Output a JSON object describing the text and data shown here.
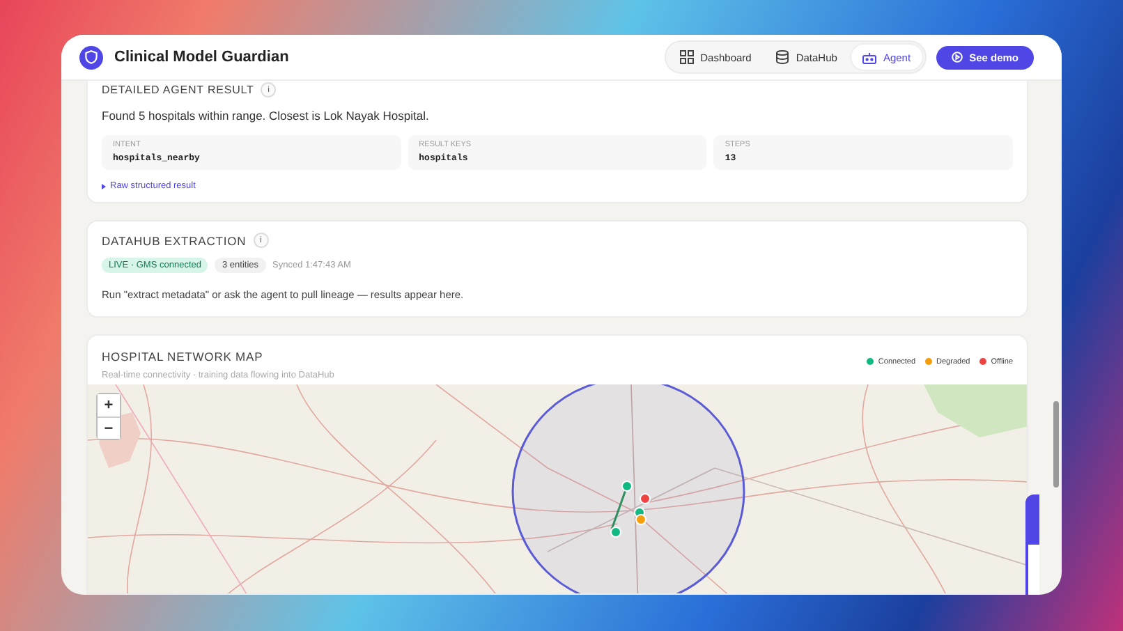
{
  "header": {
    "title": "Clinical Model Guardian",
    "nav": [
      {
        "label": "Dashboard",
        "kind": "grid",
        "selected": false
      },
      {
        "label": "DataHub",
        "kind": "database",
        "selected": false
      },
      {
        "label": "Agent",
        "kind": "bot",
        "selected": true
      }
    ],
    "demo_button": "See demo"
  },
  "agent_result": {
    "title": "DETAILED AGENT RESULT",
    "info": "i",
    "summary": "Found 5 hospitals within range. Closest is Lok Nayak Hospital.",
    "fields": [
      {
        "label": "INTENT",
        "value": "hospitals_nearby"
      },
      {
        "label": "RESULT KEYS",
        "value": "hospitals"
      },
      {
        "label": "STEPS",
        "value": "13"
      }
    ],
    "raw_link": "Raw structured result"
  },
  "datahub": {
    "title": "DATAHUB EXTRACTION",
    "info": "i",
    "badges": [
      {
        "label": "LIVE · GMS connected",
        "kind": "live"
      },
      {
        "label": "3 entities",
        "kind": "count"
      }
    ],
    "synced": "Synced 1:47:43 AM",
    "message": "Run \"extract metadata\" or ask the agent to pull lineage — results appear here."
  },
  "map": {
    "title": "HOSPITAL NETWORK MAP",
    "subtitle": "Real-time connectivity · training data flowing into DataHub",
    "legend": [
      {
        "label": "Connected",
        "color": "#10b981"
      },
      {
        "label": "Degraded",
        "color": "#f59e0b"
      },
      {
        "label": "Offline",
        "color": "#ef4444"
      }
    ],
    "zoom_in": "+",
    "zoom_out": "−"
  }
}
